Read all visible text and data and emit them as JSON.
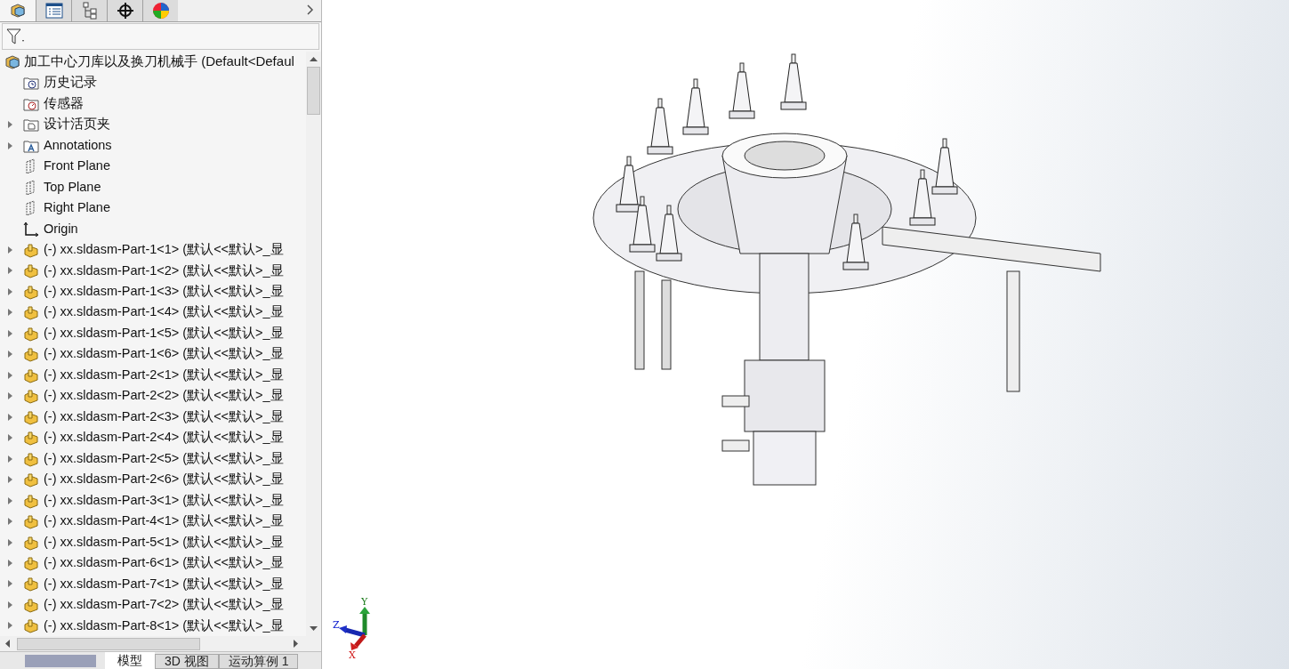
{
  "panel_tabs": [
    {
      "kind": "assembly",
      "selected": true
    },
    {
      "kind": "properties",
      "selected": false
    },
    {
      "kind": "config",
      "selected": false
    },
    {
      "kind": "crosshair",
      "selected": false
    },
    {
      "kind": "appearance",
      "selected": false
    }
  ],
  "tree": {
    "root": "加工中心刀库以及换刀机械手  (Default<Defaul",
    "items": [
      {
        "label": "历史记录",
        "kind": "history",
        "collapsible": false
      },
      {
        "label": "传感器",
        "kind": "sensor",
        "collapsible": false
      },
      {
        "label": "设计活页夹",
        "kind": "folder",
        "collapsible": true
      },
      {
        "label": "Annotations",
        "kind": "annotations",
        "collapsible": true
      },
      {
        "label": "Front Plane",
        "kind": "plane",
        "collapsible": false
      },
      {
        "label": "Top Plane",
        "kind": "plane",
        "collapsible": false
      },
      {
        "label": "Right Plane",
        "kind": "plane",
        "collapsible": false
      },
      {
        "label": "Origin",
        "kind": "origin",
        "collapsible": false
      },
      {
        "label": "(-) xx.sldasm-Part-1<1> (默认<<默认>_显",
        "kind": "part",
        "collapsible": true
      },
      {
        "label": "(-) xx.sldasm-Part-1<2> (默认<<默认>_显",
        "kind": "part",
        "collapsible": true
      },
      {
        "label": "(-) xx.sldasm-Part-1<3> (默认<<默认>_显",
        "kind": "part",
        "collapsible": true
      },
      {
        "label": "(-) xx.sldasm-Part-1<4> (默认<<默认>_显",
        "kind": "part",
        "collapsible": true
      },
      {
        "label": "(-) xx.sldasm-Part-1<5> (默认<<默认>_显",
        "kind": "part",
        "collapsible": true
      },
      {
        "label": "(-) xx.sldasm-Part-1<6> (默认<<默认>_显",
        "kind": "part",
        "collapsible": true
      },
      {
        "label": "(-) xx.sldasm-Part-2<1> (默认<<默认>_显",
        "kind": "part",
        "collapsible": true
      },
      {
        "label": "(-) xx.sldasm-Part-2<2> (默认<<默认>_显",
        "kind": "part",
        "collapsible": true
      },
      {
        "label": "(-) xx.sldasm-Part-2<3> (默认<<默认>_显",
        "kind": "part",
        "collapsible": true
      },
      {
        "label": "(-) xx.sldasm-Part-2<4> (默认<<默认>_显",
        "kind": "part",
        "collapsible": true
      },
      {
        "label": "(-) xx.sldasm-Part-2<5> (默认<<默认>_显",
        "kind": "part",
        "collapsible": true
      },
      {
        "label": "(-) xx.sldasm-Part-2<6> (默认<<默认>_显",
        "kind": "part",
        "collapsible": true
      },
      {
        "label": "(-) xx.sldasm-Part-3<1> (默认<<默认>_显",
        "kind": "part",
        "collapsible": true
      },
      {
        "label": "(-) xx.sldasm-Part-4<1> (默认<<默认>_显",
        "kind": "part",
        "collapsible": true
      },
      {
        "label": "(-) xx.sldasm-Part-5<1> (默认<<默认>_显",
        "kind": "part",
        "collapsible": true
      },
      {
        "label": "(-) xx.sldasm-Part-6<1> (默认<<默认>_显",
        "kind": "part",
        "collapsible": true
      },
      {
        "label": "(-) xx.sldasm-Part-7<1> (默认<<默认>_显",
        "kind": "part",
        "collapsible": true
      },
      {
        "label": "(-) xx.sldasm-Part-7<2> (默认<<默认>_显",
        "kind": "part",
        "collapsible": true
      },
      {
        "label": "(-) xx.sldasm-Part-8<1> (默认<<默认>_显",
        "kind": "part",
        "collapsible": true
      }
    ]
  },
  "bottom_tabs": [
    {
      "label": "模型",
      "selected": true
    },
    {
      "label": "3D 视图",
      "selected": false
    },
    {
      "label": "运动算例 1",
      "selected": false
    }
  ],
  "triad": {
    "x": "X",
    "y": "Y",
    "z": "Z"
  }
}
